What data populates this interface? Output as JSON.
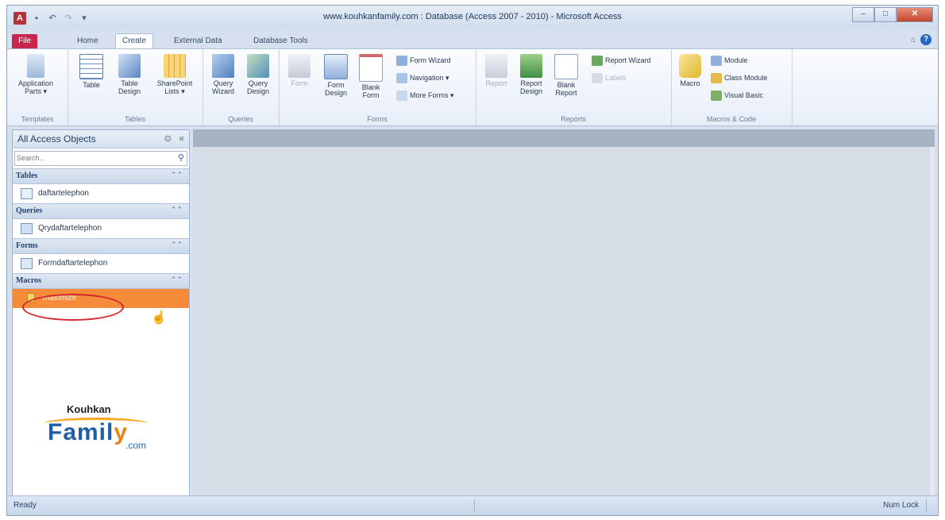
{
  "window": {
    "title": "www.kouhkanfamily.com : Database (Access 2007 - 2010) - Microsoft Access",
    "app_icon": "A",
    "controls": {
      "minimize": "–",
      "maximize": "□",
      "close": "✕"
    }
  },
  "quick_access": {
    "save": "💾",
    "undo": "↶",
    "redo": "↷",
    "customize": "▾"
  },
  "tabs": [
    "File",
    "Home",
    "Create",
    "External Data",
    "Database Tools"
  ],
  "ribbon": {
    "templates": {
      "label": "Templates",
      "app_parts": "Application Parts ▾"
    },
    "tables": {
      "label": "Tables",
      "table": "Table",
      "table_design": "Table Design",
      "sharepoint": "SharePoint Lists ▾"
    },
    "queries": {
      "label": "Queries",
      "wizard": "Query Wizard",
      "design": "Query Design"
    },
    "forms": {
      "label": "Forms",
      "form": "Form",
      "form_design": "Form Design",
      "blank_form": "Blank Form",
      "form_wizard": "Form Wizard",
      "navigation": "Navigation ▾",
      "more_forms": "More Forms ▾"
    },
    "reports": {
      "label": "Reports",
      "report": "Report",
      "report_design": "Report Design",
      "blank_report": "Blank Report",
      "report_wizard": "Report Wizard",
      "labels": "Labels"
    },
    "macros": {
      "label": "Macros & Code",
      "macro": "Macro",
      "module": "Module",
      "class_module": "Class Module",
      "visual_basic": "Visual Basic"
    }
  },
  "nav": {
    "title": "All Access Objects",
    "search_placeholder": "Search...",
    "groups": [
      {
        "name": "Tables",
        "items": [
          "daftartelephon"
        ]
      },
      {
        "name": "Queries",
        "items": [
          "Qrydaftartelephon"
        ]
      },
      {
        "name": "Forms",
        "items": [
          "Formdaftartelephon"
        ]
      },
      {
        "name": "Macros",
        "items": [
          "maximize"
        ]
      }
    ]
  },
  "logo": {
    "top": "Kouhkan",
    "main_a": "Famil",
    "main_b": "y",
    "suffix": ".com"
  },
  "status": {
    "left": "Ready",
    "right": "Num Lock"
  },
  "colors": {
    "accent": "#c8264f",
    "selected": "#f68b39",
    "highlight_oval": "#d2272e"
  }
}
